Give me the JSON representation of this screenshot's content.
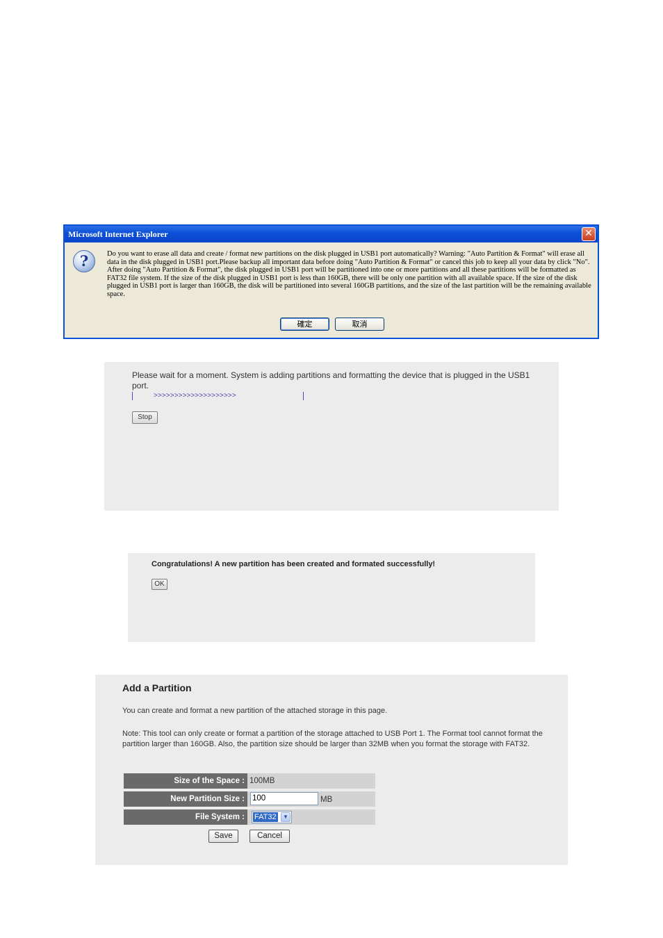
{
  "dialog": {
    "title": "Microsoft Internet Explorer",
    "close_symbol": "✕",
    "icon_symbol": "?",
    "message": "Do you want to erase all data and create / format new partitions on the disk plugged in USB1 port automatically? Warning: \"Auto Partition & Format\" will erase all data in the disk plugged in USB1 port.Please backup all important data before doing \"Auto Partition & Format\" or cancel this job to keep all your data by click \"No\". After doing \"Auto Partition & Format\", the disk plugged in USB1 port will be partitioned into one or more partitions and all these partitions will be formatted as FAT32 file system. If the size of the disk plugged in USB1 port is less than 160GB, there will be only one partition with all available space. If the size of the disk plugged in USB1 port is larger than 160GB, the disk will be partitioned into several 160GB partitions, and the size of the last partition will be the remaining available space.",
    "ok_label": "確定",
    "cancel_label": "取消"
  },
  "wait_panel": {
    "message": "Please wait for a moment. System is adding partitions and formatting the device that is plugged in the USB1 port.",
    "progress_arrows": ">>>>>>>>>>>>>>>>>>>>",
    "stop_label": "Stop"
  },
  "congrats_panel": {
    "message": "Congratulations! A new partition has been created and formated successfully!",
    "ok_label": "OK"
  },
  "partition_panel": {
    "title": "Add a Partition",
    "intro": "You can create and format a new partition of the attached storage in this page.",
    "note": "Note: This tool can only create or format a partition of the storage attached to USB Port 1. The Format tool cannot format the partition larger than 160GB. Also, the partition size should be larger than 32MB when you format the storage with FAT32.",
    "size_label": "Size of the Space :",
    "size_value": "100MB",
    "new_size_label": "New Partition Size :",
    "new_size_value": "100",
    "new_size_unit": "MB",
    "fs_label": "File System :",
    "fs_value": "FAT32",
    "save_label": "Save",
    "cancel_label": "Cancel"
  }
}
